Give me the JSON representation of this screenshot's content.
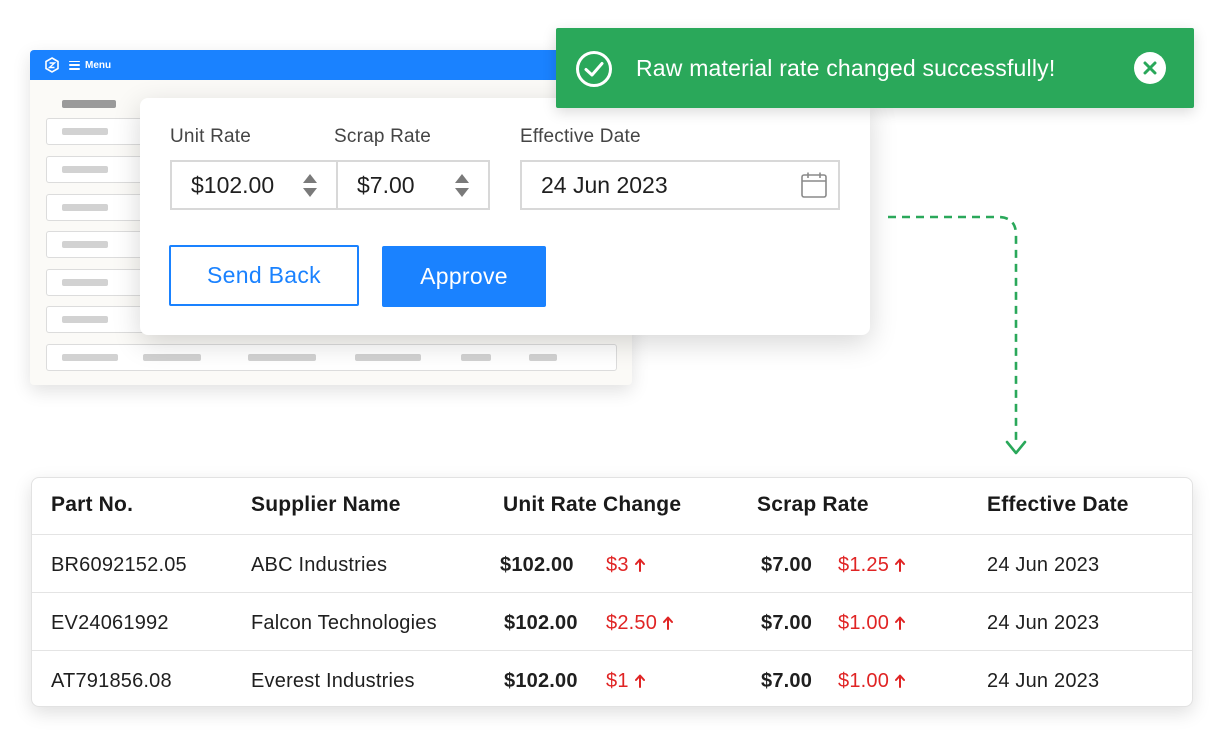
{
  "background_app": {
    "menu_label": "Menu",
    "logo_icon": "app-logo-icon",
    "menu_icon": "hamburger-menu-icon",
    "accent_color": "#1a82ff"
  },
  "rate_form": {
    "unit_rate_label": "Unit Rate",
    "unit_rate_value": "$102.00",
    "scrap_rate_label": "Scrap Rate",
    "scrap_rate_value": "$7.00",
    "effective_date_label": "Effective Date",
    "effective_date_value": "24 Jun 2023",
    "send_back_label": "Send Back",
    "approve_label": "Approve"
  },
  "toast": {
    "message": "Raw material rate changed successfully!",
    "icon": "check-circle-icon",
    "close_icon": "close-icon",
    "color": "#2aa85a"
  },
  "table": {
    "headers": [
      "Part No.",
      "Supplier Name",
      "Unit Rate Change",
      "Scrap Rate",
      "Effective Date"
    ],
    "rows": [
      {
        "part_no": "BR6092152.05",
        "supplier": "ABC Industries",
        "unit_rate": "$102.00",
        "unit_delta": "$3",
        "scrap_rate": "$7.00",
        "scrap_delta": "$1.25",
        "date": "24 Jun 2023"
      },
      {
        "part_no": "EV24061992",
        "supplier": "Falcon Technologies",
        "unit_rate": "$102.00",
        "unit_delta": "$2.50",
        "scrap_rate": "$7.00",
        "scrap_delta": "$1.00",
        "date": "24 Jun 2023"
      },
      {
        "part_no": "AT791856.08",
        "supplier": "Everest Industries",
        "unit_rate": "$102.00",
        "unit_delta": "$1",
        "scrap_rate": "$7.00",
        "scrap_delta": "$1.00",
        "date": "24 Jun 2023"
      }
    ],
    "delta_color": "#e02424"
  }
}
